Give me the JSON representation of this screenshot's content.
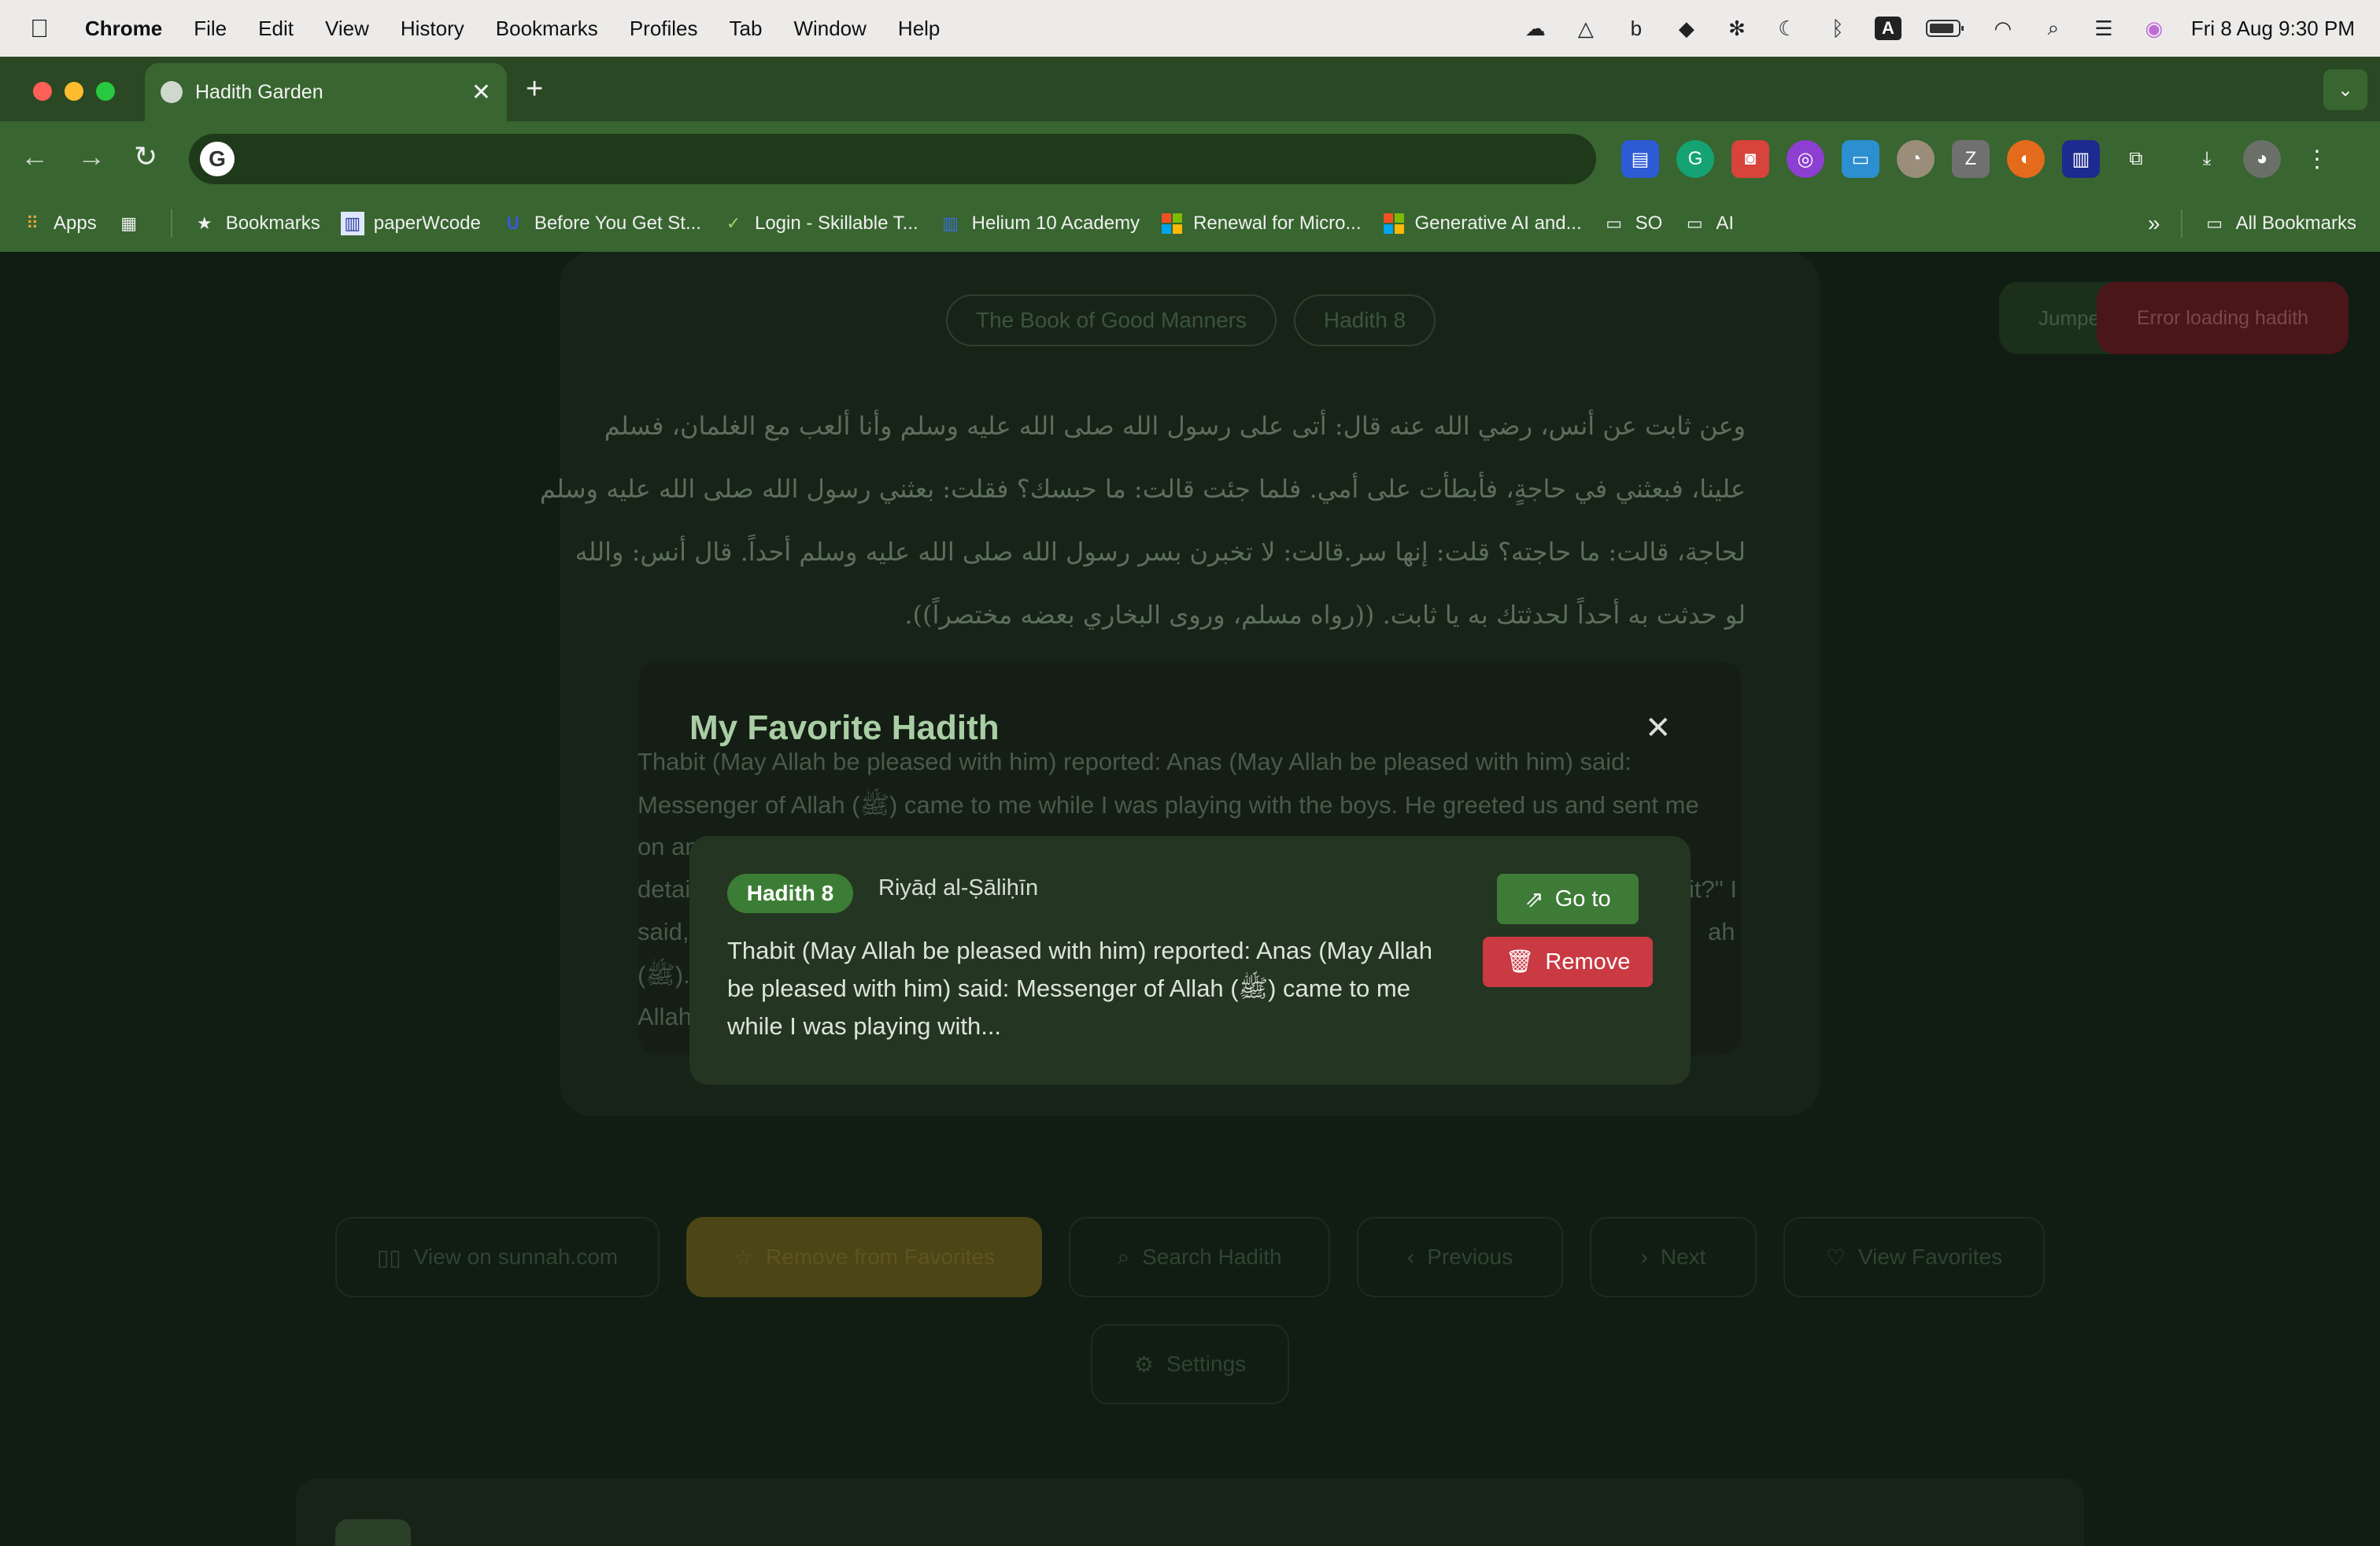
{
  "menubar": {
    "app_name": "Chrome",
    "items": [
      "File",
      "Edit",
      "View",
      "History",
      "Bookmarks",
      "Profiles",
      "Tab",
      "Window",
      "Help"
    ],
    "datetime": "Fri 8 Aug  9:30 PM"
  },
  "browser": {
    "tab_title": "Hadith Garden",
    "bookmarks": [
      "Apps",
      "Bookmarks",
      "paperWcode",
      "Before You Get St...",
      "Login - Skillable T...",
      "Helium 10 Academy",
      "Renewal for Micro...",
      "Generative AI and...",
      "SO",
      "AI"
    ],
    "all_bookmarks": "All Bookmarks"
  },
  "page": {
    "book_pill": "The Book of Good Manners",
    "hadith_pill": "Hadith 8",
    "arabic_lines": [
      "وعن ثابت عن أنس، رضي الله عنه قال: أتى على رسول الله صلى الله عليه وسلم وأنا ألعب مع الغلمان، فسلم",
      "علينا، فبعثني في حاجةٍ، فأبطأت على أمي. فلما جئت قالت: ما حبسك؟ فقلت: بعثني رسول الله صلى الله عليه وسلم",
      "لحاجة، قالت: ما حاجته؟ قلت: إنها سر.قالت: لا تخبرن بسر رسول الله صلى الله عليه وسلم أحداً. قال أنس: والله",
      "لو حدثت به أحداً لحدثتك به يا ثابت. ((رواه مسلم، وروى البخاري بعضه مختصراً))."
    ],
    "english_lines": [
      "Thabit (May Allah be pleased with him) reported: Anas (May Allah be pleased with him) said:",
      "Messenger of Allah (ﷺ) came to me while I was playing with the boys. He greeted us and sent me",
      "on an",
      "detai",
      "said,",
      "(ﷺ).",
      "Allah"
    ],
    "english_right_fragments": [
      "it?\" I",
      "ah"
    ],
    "buttons": {
      "view_sunnah": "View on sunnah.com",
      "remove_fav": "Remove from Favorites",
      "search": "Search Hadith",
      "previous": "Previous",
      "next": "Next",
      "view_favorites": "View Favorites",
      "settings": "Settings"
    },
    "toast_jump": "Jumpe",
    "toast_error": "Error loading hadith"
  },
  "modal": {
    "title": "My Favorite Hadith",
    "card": {
      "badge": "Hadith 8",
      "book": "Riyāḍ al-Ṣāliḥīn",
      "excerpt": "Thabit (May Allah be pleased with him) reported: Anas (May Allah be pleased with him) said: Messenger of Allah (ﷺ) came to me while I was playing with...",
      "goto_label": "Go to",
      "remove_label": "Remove"
    }
  },
  "colors": {
    "brand_green": "#3c7d35",
    "danger_red": "#c93a43",
    "chrome_green": "#386530"
  }
}
